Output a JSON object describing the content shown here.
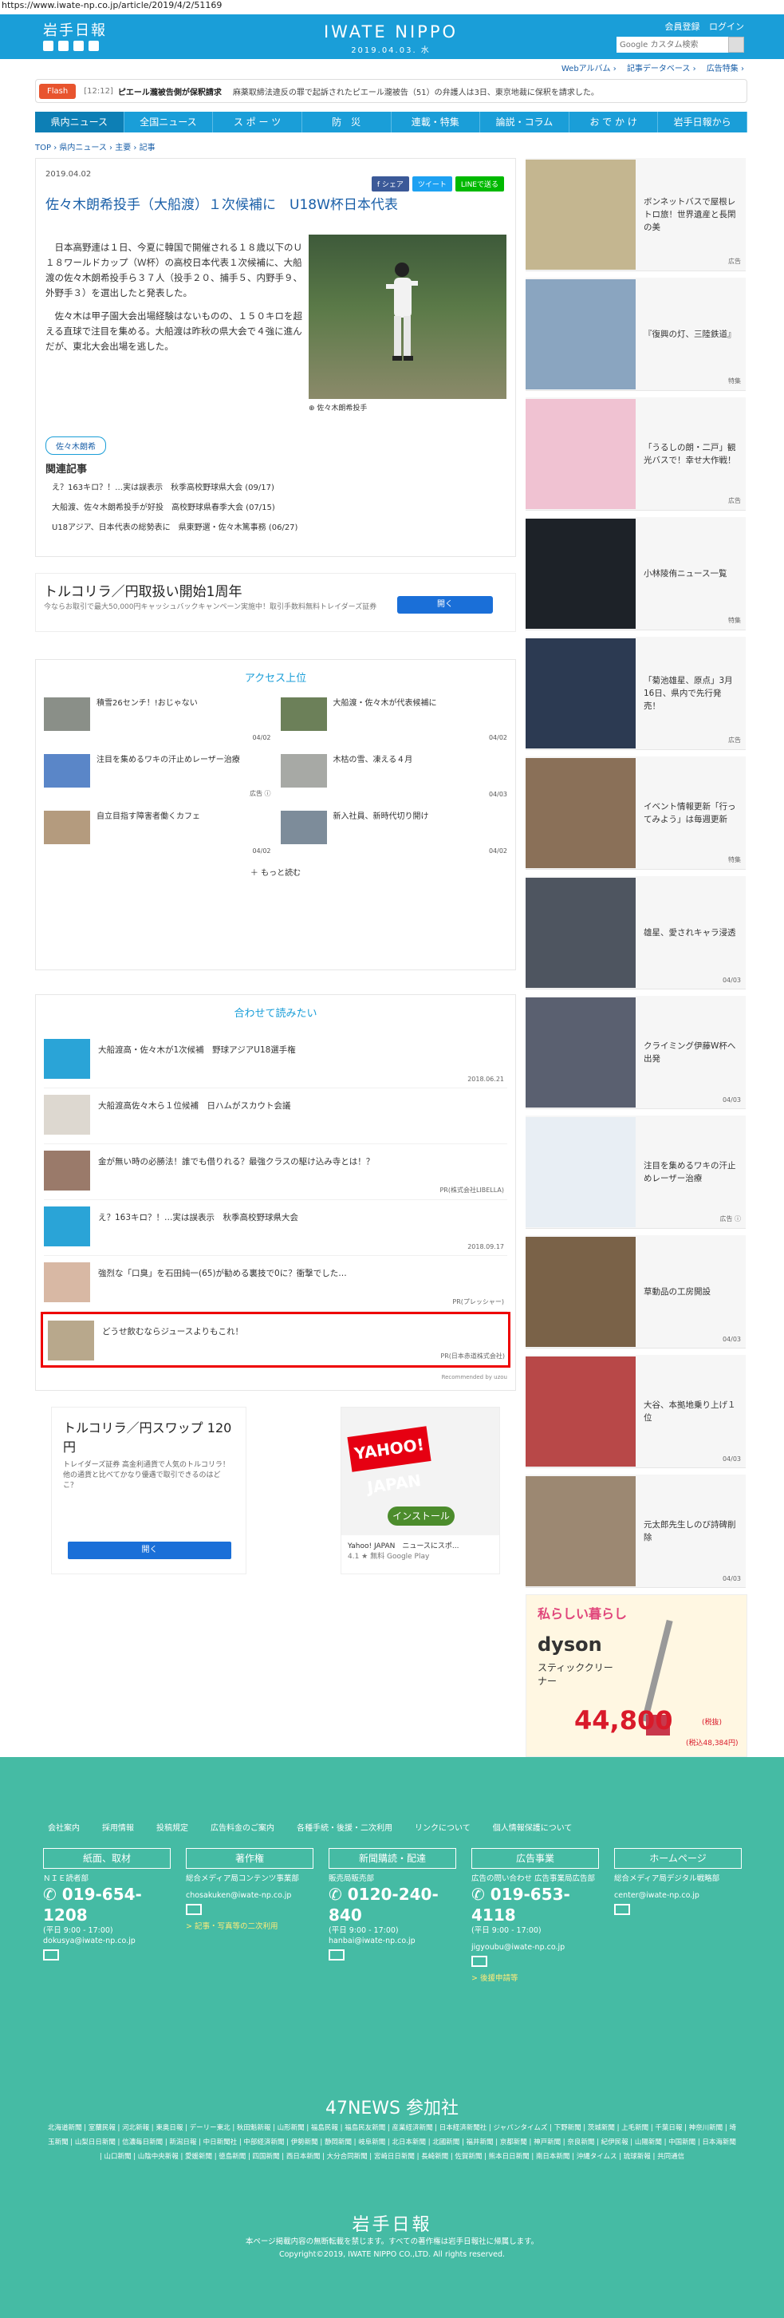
{
  "url": "https://www.iwate-np.co.jp/article/2019/4/2/51169",
  "header": {
    "logo": "岩手日報",
    "brand": "IWATE NIPPO",
    "date": "2019.04.03. 水",
    "login_links": [
      "会員登録",
      "ログイン"
    ],
    "search_placeholder": "Google カスタム検索",
    "sub_links": [
      "Webアルバム ›",
      "記事データベース ›",
      "広告特集 ›"
    ]
  },
  "flash": {
    "tag": "Flash",
    "time": "[12:12]",
    "headline": "ピエール瀧被告側が保釈請求",
    "text": "麻薬取締法違反の罪で起訴されたピエール瀧被告（51）の弁護人は3日、東京地裁に保釈を請求した。"
  },
  "nav": [
    "県内ニュース",
    "全国ニュース",
    "ス ポ ー ツ",
    "防　災",
    "連載・特集",
    "論説・コラム",
    "お で か け",
    "岩手日報から"
  ],
  "breadcrumb": "TOP › 県内ニュース › 主要 › 記事",
  "article": {
    "date": "2019.04.02",
    "share": [
      "f シェア",
      "ツイート",
      "LINEで送る"
    ],
    "title": "佐々木朗希投手（大船渡）１次候補に　U18W杯日本代表",
    "p1": "日本高野連は１日、今夏に韓国で開催される１８歳以下のＵ１８ワールドカップ（Ｗ杯）の高校日本代表１次候補に、大船渡の佐々木朗希投手ら３７人（投手２０、捕手５、内野手９、外野手３）を選出したと発表した。",
    "p2": "佐々木は甲子園大会出場経験はないものの、１５０キロを超える直球で注目を集める。大船渡は昨秋の県大会で４強に進んだが、東北大会出場を逃した。",
    "caption": "佐々木朗希投手",
    "tag": "佐々木朗希",
    "related_heading": "関連記事",
    "related": [
      "え？163キロ？！…実は誤表示　秋季高校野球県大会 (09/17)",
      "大船渡、佐々木朗希投手が好投　高校野球県春季大会 (07/15)",
      "U18アジア、日本代表の総勢表に　県東野選・佐々木篤事務 (06/27)"
    ]
  },
  "ad1": {
    "title": "トルコリラ／円取扱い開始1周年",
    "sub": "今ならお取引で最大50,000円キャッシュバックキャンペーン実施中！取引手数料無料トレイダーズ証券",
    "button": "開く"
  },
  "access": {
    "heading": "アクセス上位",
    "items": [
      {
        "text": "積雪26センチ！!おじゃない",
        "date": "04/02"
      },
      {
        "text": "大船渡・佐々木が代表候補に",
        "date": "04/02"
      },
      {
        "text": "注目を集めるワキの汗止めレーザー治療",
        "date": "広告 ⓘ"
      },
      {
        "text": "木枯の雪、凍える４月",
        "date": "04/03"
      },
      {
        "text": "自立目指す障害者働くカフェ",
        "date": "04/02"
      },
      {
        "text": "新入社員、新時代切り開け",
        "date": "04/02"
      }
    ],
    "more": "もっと読む"
  },
  "recommend": {
    "heading": "合わせて読みたい",
    "items": [
      {
        "text": "大船渡高・佐々木が1次候補　野球アジアU18選手権",
        "src": "2018.06.21"
      },
      {
        "text": "大船渡高佐々木ら１位候補　日ハムがスカウト会議",
        "src": ""
      },
      {
        "text": "金が無い時の必勝法！誰でも借りれる？最強クラスの駆け込み寺とは！？",
        "src": "PR(株式会社LIBELLA)"
      },
      {
        "text": "え？163キロ？！…実は誤表示　秋季高校野球県大会",
        "src": "2018.09.17"
      },
      {
        "text": "強烈な「口臭」を石田純一(65)が勧める裏技で0に？衝撃でした…",
        "src": "PR(プレッシャー)"
      },
      {
        "text": "どうせ飲むならジュースよりもこれ！",
        "src": "PR(日本赤道株式会社)"
      }
    ],
    "by": "Recommended by uzou"
  },
  "ad2": {
    "title": "トルコリラ／円スワップ 120円",
    "sub": "トレイダーズ証券\n高金利通貨で人気のトルコリラ！他の通貨と比べてかなり優遇で取引できるのはどこ？",
    "button": "開く"
  },
  "ad3": {
    "brand": "YAHOO! JAPAN",
    "install": "インストール",
    "app": "Yahoo! JAPAN　ニュースにスポ...",
    "rating": "4.1 ★ 無料  Google Play"
  },
  "side": [
    {
      "text": "ボンネットバスで屋根レトロ旅！世界遺産と長閑の美",
      "label": "広告"
    },
    {
      "text": "『復興の灯、三陸鉄道』",
      "label": "特集"
    },
    {
      "text": "「うるしの朗・二戸」観光バスで！幸せ大作戦！",
      "label": "広告"
    },
    {
      "text": "小林陵侑ニュース一覧",
      "label": "特集"
    },
    {
      "text": "「菊池雄星、原点」3月16日、県内で先行発売！",
      "label": "広告"
    },
    {
      "text": "イベント情報更新「行ってみよう」は毎週更新",
      "label": "特集"
    },
    {
      "text": "雄星、愛されキャラ浸透",
      "label": "04/03"
    },
    {
      "text": "クライミング伊藤W杯へ出発",
      "label": "04/03"
    },
    {
      "text": "注目を集めるワキの汗止めレーザー治療",
      "label": "広告 ⓘ"
    },
    {
      "text": "草動品の工房開設",
      "label": "04/03"
    },
    {
      "text": "大谷、本拠地乗り上げ１位",
      "label": "04/03"
    },
    {
      "text": "元太郎先生しのび詩碑削除",
      "label": "04/03"
    }
  ],
  "side_ad": {
    "top": "私らしい暮らし",
    "brand": "dyson",
    "product": "スティッククリーナー",
    "price": "44,800",
    "tax": "(税抜)",
    "tax2": "(税込48,384円)"
  },
  "footer": {
    "links": [
      "会社案内",
      "採用情報",
      "投稿規定",
      "広告料金のご案内",
      "各種手続・後援・二次利用",
      "リンクについて",
      "個人情報保護について"
    ],
    "cols": [
      {
        "hd": "紙面、取材",
        "l1": "ＮＩＥ読者部",
        "tel": "019-654-1208",
        "hours": "(平日 9:00 - 17:00)",
        "mail": "dokusya@iwate-np.co.jp",
        "extra": ""
      },
      {
        "hd": "著作権",
        "l1": "総合メディア局コンテンツ事業部",
        "tel": "",
        "hours": "",
        "mail": "chosakuken@iwate-np.co.jp",
        "extra": "> 記事・写真等の二次利用"
      },
      {
        "hd": "新聞購読・配達",
        "l1": "販売局販売部",
        "tel": "0120-240-840",
        "hours": "(平日 9:00 - 17:00)",
        "mail": "hanbai@iwate-np.co.jp",
        "extra": ""
      },
      {
        "hd": "広告事業",
        "l1": "広告の問い合わせ 広告事業局広告部",
        "tel": "019-653-4118",
        "hours": "(平日 9:00 - 17:00)",
        "mail": "jigyoubu@iwate-np.co.jp",
        "extra": "> 後援申請等"
      },
      {
        "hd": "ホームページ",
        "l1": "総合メディア局デジタル戦略部",
        "tel": "",
        "hours": "",
        "mail": "center@iwate-np.co.jp",
        "extra": ""
      }
    ],
    "n47": "47NEWS 参加社",
    "papers": "北海道新聞 | 室蘭民報 | 河北新報 | 東奥日報 | デーリー東北 | 秋田魁新報 | 山形新聞 | 福島民報 | 福島民友新聞 | 産業経済新聞 | 日本経済新聞社 | ジャパンタイムズ | 下野新聞 | 茨城新聞 | 上毛新聞 | 千葉日報 | 神奈川新聞 | 埼玉新聞 | 山梨日日新聞 | 信濃毎日新聞 | 新潟日報 | 中日新聞社 | 中部経済新聞 | 伊勢新聞 | 静岡新聞 | 岐阜新聞 | 北日本新聞 | 北國新聞 | 福井新聞 | 京都新聞 | 神戸新聞 | 奈良新聞 | 紀伊民報 | 山陽新聞 | 中国新聞 | 日本海新聞 | 山口新聞 | 山陰中央新報 | 愛媛新聞 | 徳島新聞 | 四国新聞 | 西日本新聞 | 大分合同新聞 | 宮崎日日新聞 | 長崎新聞 | 佐賀新聞 | 熊本日日新聞 | 南日本新聞 | 沖縄タイムス | 琉球新報 | 共同通信",
    "logo": "岩手日報",
    "notice": "本ページ掲載内容の無断転載を禁じます。すべての著作権は岩手日報社に帰属します。",
    "copy": "Copyright©2019, IWATE NIPPO CO.,LTD. All rights reserved."
  }
}
